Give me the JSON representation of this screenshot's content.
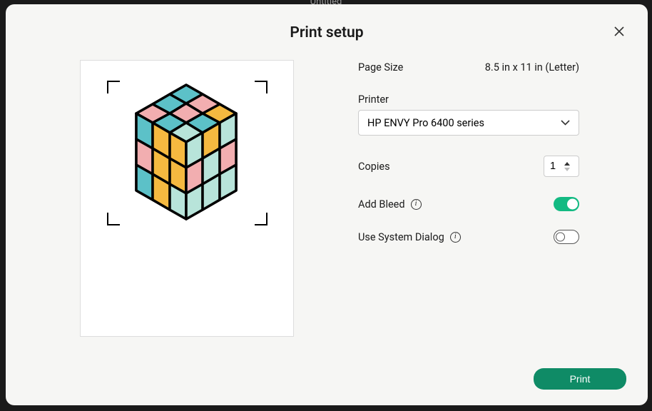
{
  "background": {
    "title": "Untitled"
  },
  "modal": {
    "title": "Print setup"
  },
  "pageSize": {
    "label": "Page Size",
    "value": "8.5 in x 11 in (Letter)"
  },
  "printer": {
    "label": "Printer",
    "selected": "HP ENVY Pro 6400 series"
  },
  "copies": {
    "label": "Copies",
    "value": "1"
  },
  "addBleed": {
    "label": "Add Bleed",
    "enabled": true
  },
  "useSystemDialog": {
    "label": "Use System Dialog",
    "enabled": false
  },
  "actions": {
    "print": "Print"
  },
  "colors": {
    "accent": "#0f8b66",
    "toggleOn": "#13ba82"
  }
}
